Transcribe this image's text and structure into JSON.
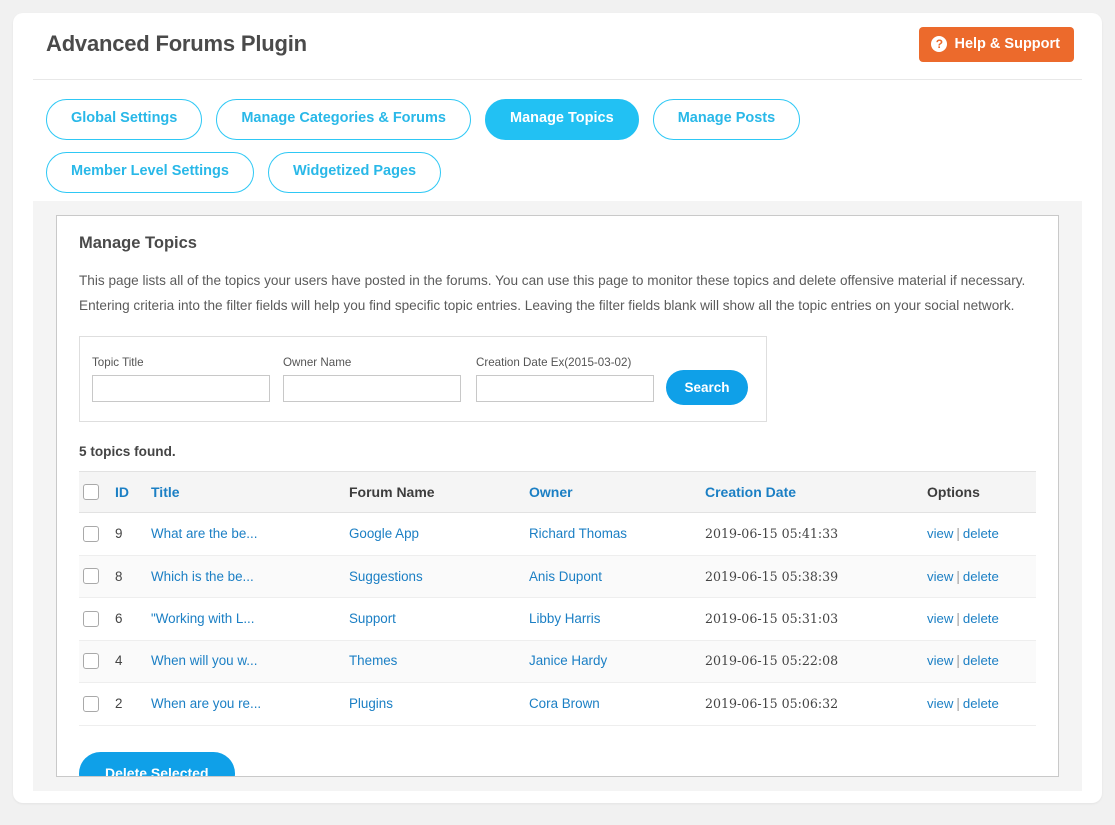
{
  "header": {
    "title": "Advanced Forums Plugin",
    "help_button": "Help & Support",
    "help_icon": "question-circle-icon"
  },
  "tabs": [
    {
      "label": "Global Settings",
      "active": false
    },
    {
      "label": "Manage Categories & Forums",
      "active": false
    },
    {
      "label": "Manage Topics",
      "active": true
    },
    {
      "label": "Manage Posts",
      "active": false
    },
    {
      "label": "Member Level Settings",
      "active": false
    },
    {
      "label": "Widgetized Pages",
      "active": false
    }
  ],
  "panel": {
    "title": "Manage Topics",
    "desc_line1": "This page lists all of the topics your users have posted in the forums. You can use this page to monitor these topics and delete offensive material if necessary.",
    "desc_line2": "Entering criteria into the filter fields will help you find specific topic entries. Leaving the filter fields blank will show all the topic entries on your social network."
  },
  "filters": {
    "topic_title": {
      "label": "Topic Title",
      "value": "",
      "placeholder": ""
    },
    "owner_name": {
      "label": "Owner Name",
      "value": "",
      "placeholder": ""
    },
    "creation_date": {
      "label": "Creation Date Ex(2015-03-02)",
      "value": "",
      "placeholder": ""
    },
    "search_button": "Search"
  },
  "results": {
    "count_text": "5 topics found.",
    "columns": {
      "id": "ID",
      "title": "Title",
      "forum_name": "Forum Name",
      "owner": "Owner",
      "creation_date": "Creation Date",
      "options": "Options"
    },
    "rows": [
      {
        "id": "9",
        "title": "What are the be...",
        "forum": "Google App",
        "owner": "Richard Thomas",
        "date": "2019-06-15 05:41:33",
        "view": "view",
        "delete": "delete",
        "checked": false
      },
      {
        "id": "8",
        "title": "Which is the be...",
        "forum": "Suggestions",
        "owner": "Anis Dupont",
        "date": "2019-06-15 05:38:39",
        "view": "view",
        "delete": "delete",
        "checked": false
      },
      {
        "id": "6",
        "title": "\"Working with L...",
        "forum": "Support",
        "owner": "Libby Harris",
        "date": "2019-06-15 05:31:03",
        "view": "view",
        "delete": "delete",
        "checked": false
      },
      {
        "id": "4",
        "title": "When will you w...",
        "forum": "Themes",
        "owner": "Janice Hardy",
        "date": "2019-06-15 05:22:08",
        "view": "view",
        "delete": "delete",
        "checked": false
      },
      {
        "id": "2",
        "title": "When are you re...",
        "forum": "Plugins",
        "owner": "Cora Brown",
        "date": "2019-06-15 05:06:32",
        "view": "view",
        "delete": "delete",
        "checked": false
      }
    ],
    "option_separator": "|",
    "delete_selected_button": "Delete Selected"
  },
  "colors": {
    "accent_cyan": "#22c1f3",
    "button_blue": "#0fa0e8",
    "help_orange": "#ec6a2c",
    "link_blue": "#1b7fc4"
  }
}
